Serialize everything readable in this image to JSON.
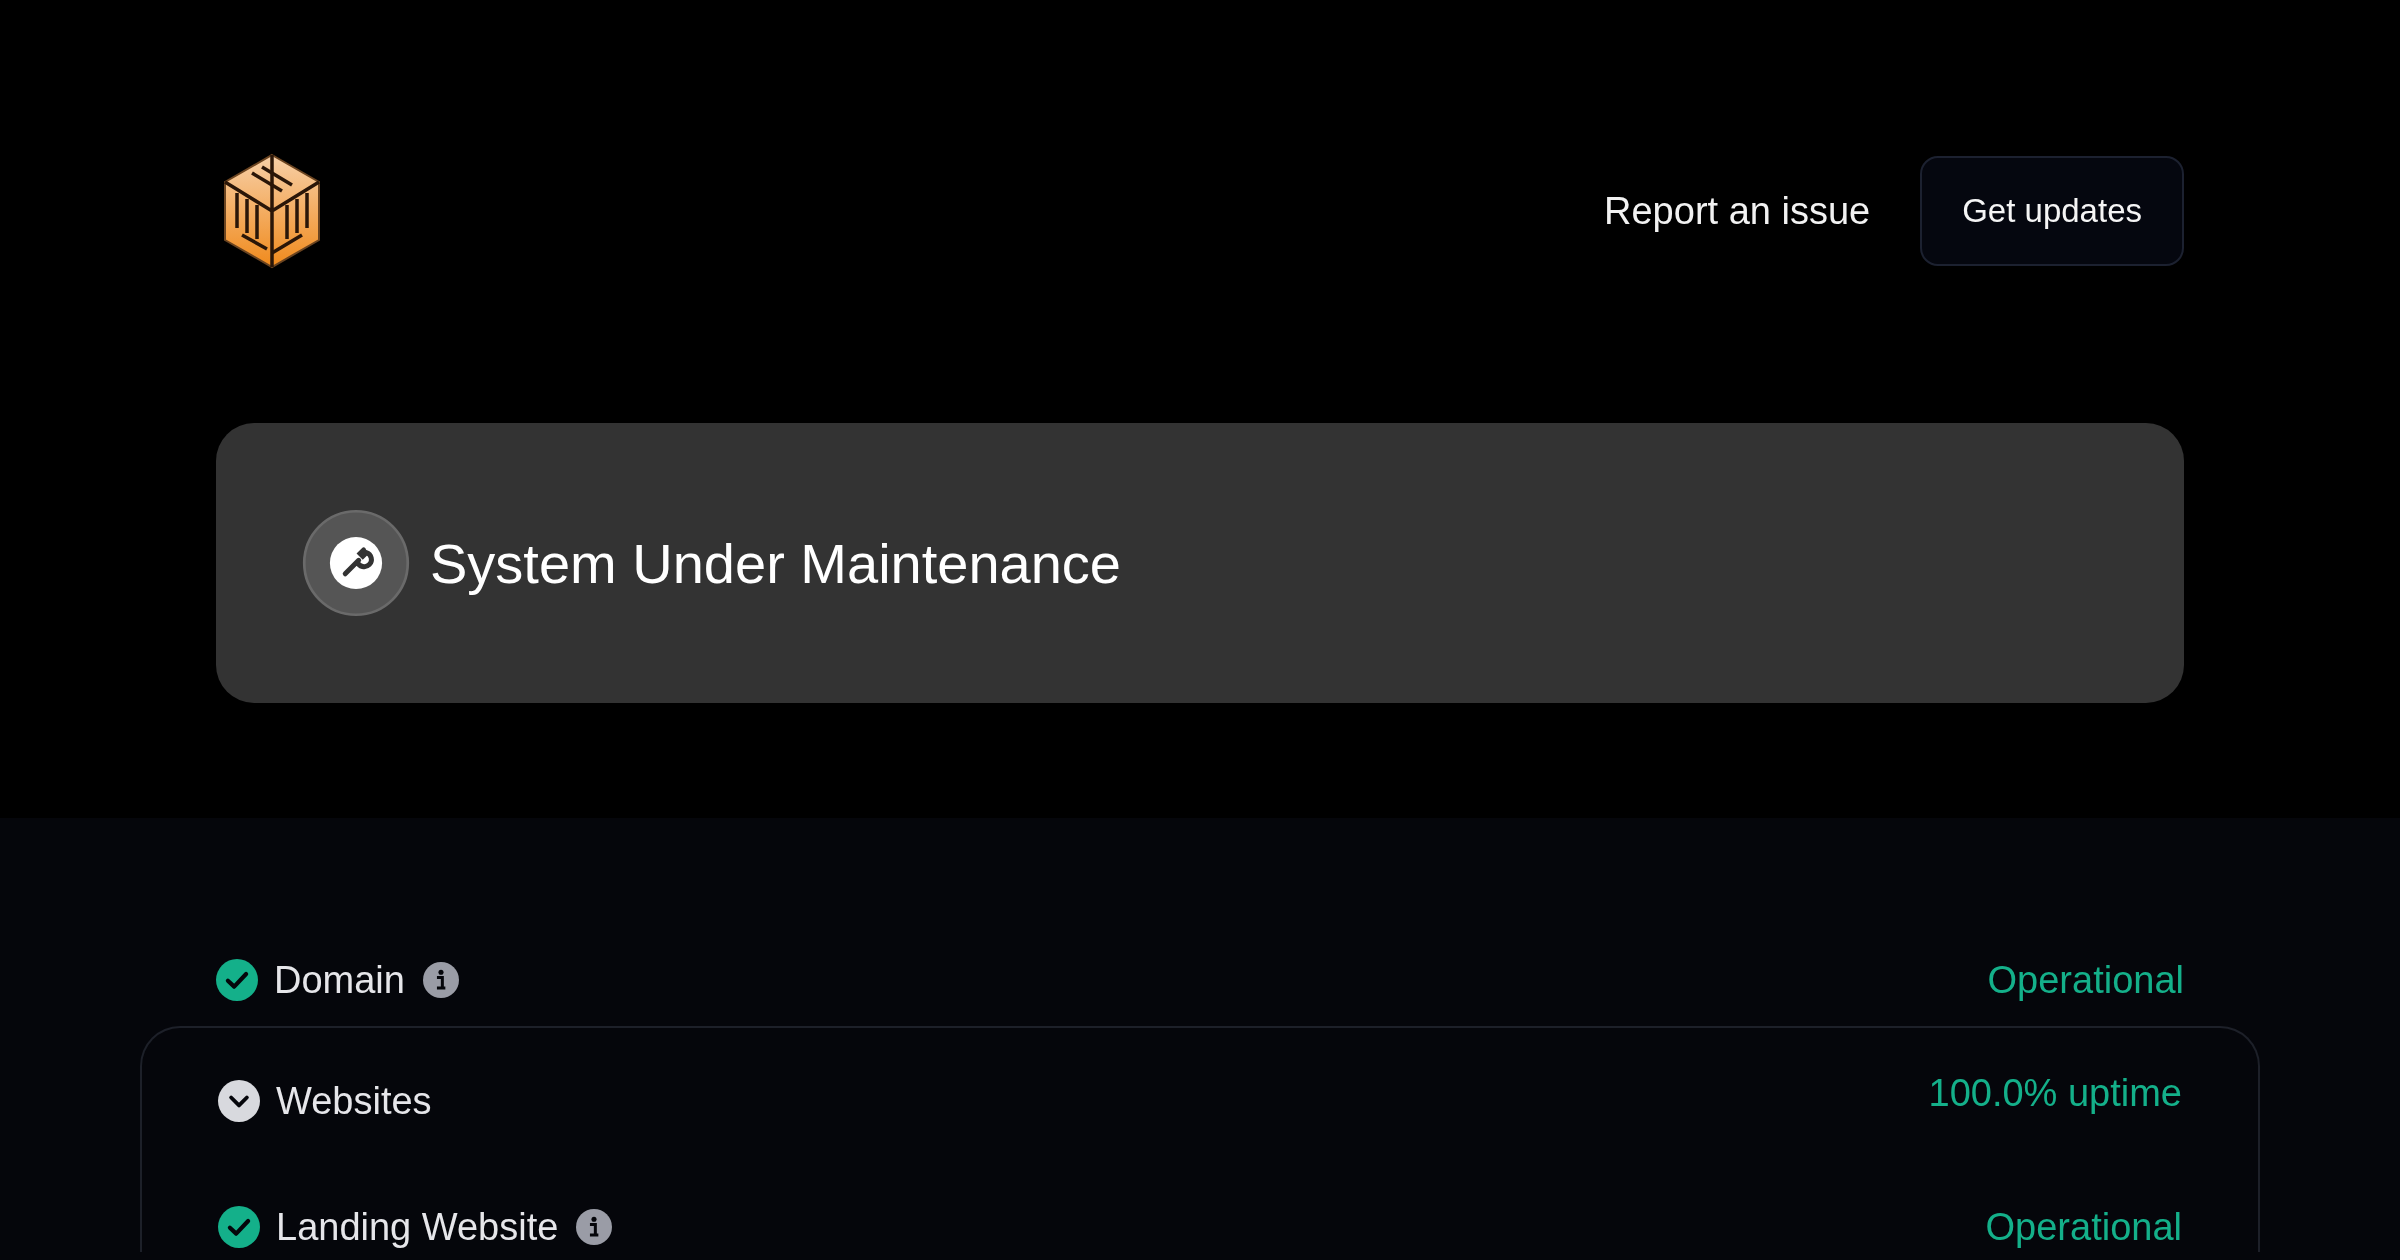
{
  "header": {
    "report_link": "Report an issue",
    "updates_button": "Get updates"
  },
  "banner": {
    "kind": "maintenance",
    "title": "System Under Maintenance"
  },
  "components": [
    {
      "kind": "single",
      "name": "Domain",
      "info": true,
      "operational": true,
      "status_text": "Operational"
    },
    {
      "kind": "group",
      "name": "Websites",
      "expanded": true,
      "uptime": "100.0% uptime",
      "children": [
        {
          "name": "Landing Website",
          "info": true,
          "operational": true,
          "status_text": "Operational"
        }
      ]
    }
  ]
}
